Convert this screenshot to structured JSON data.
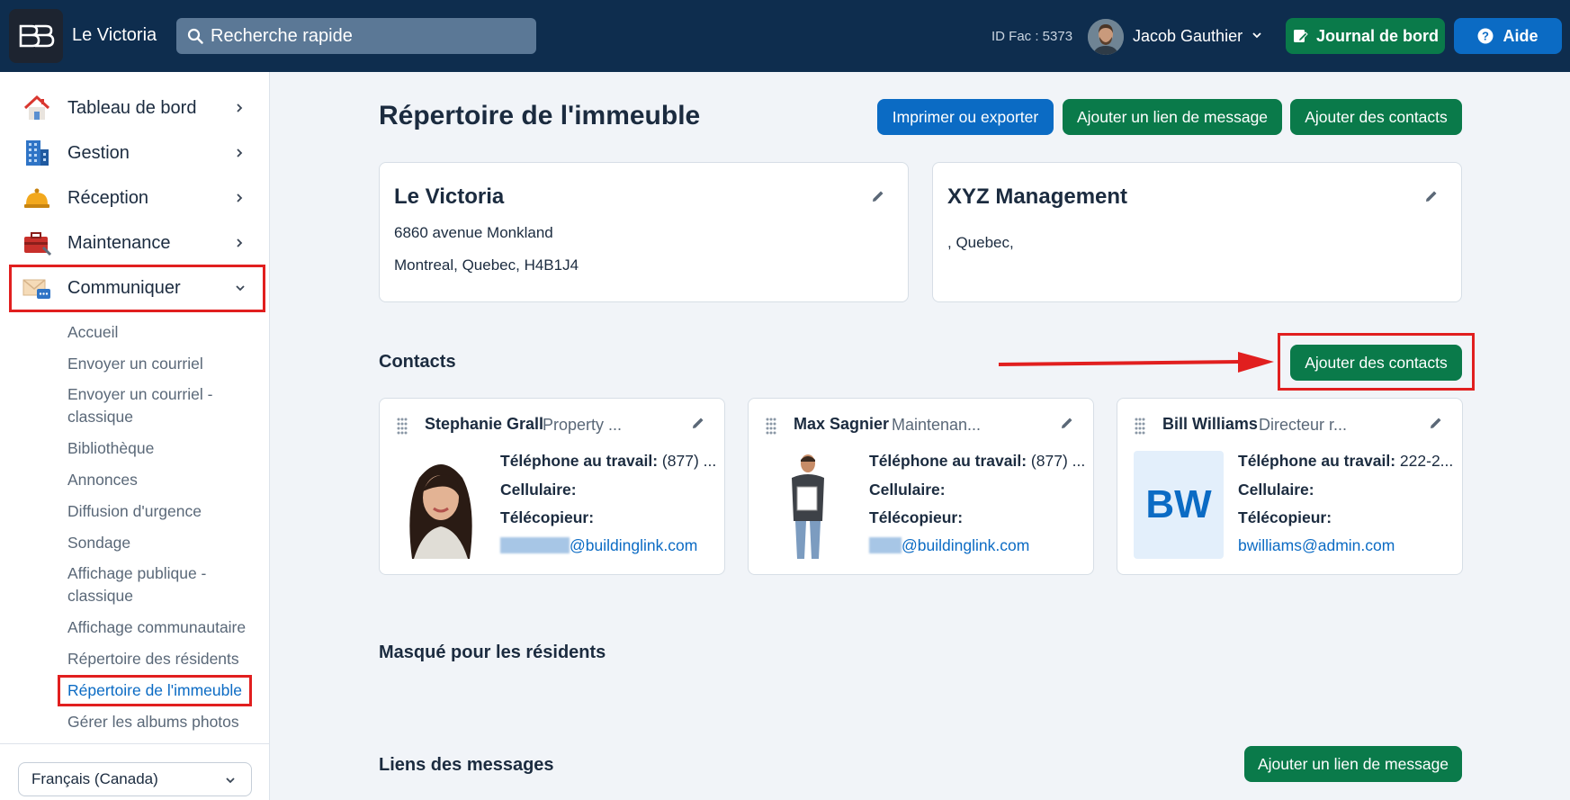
{
  "header": {
    "app_title": "Le Victoria",
    "search_placeholder": "Recherche rapide",
    "id_fac": "ID Fac : 5373",
    "user_name": "Jacob Gauthier",
    "journal_label": "Journal de bord",
    "aide_label": "Aide"
  },
  "sidebar": {
    "main_items": [
      {
        "label": "Tableau de bord",
        "icon": "house-icon"
      },
      {
        "label": "Gestion",
        "icon": "building-icon"
      },
      {
        "label": "Réception",
        "icon": "bell-icon"
      },
      {
        "label": "Maintenance",
        "icon": "toolbox-icon"
      },
      {
        "label": "Communiquer",
        "icon": "mail-chat-icon"
      }
    ],
    "sub_items": [
      "Accueil",
      "Envoyer un courriel",
      "Envoyer un courriel -",
      "classique",
      "Bibliothèque",
      "Annonces",
      "Diffusion d'urgence",
      "Sondage",
      "Affichage publique -",
      "classique",
      "Affichage communautaire",
      "Répertoire des résidents",
      "Répertoire de l'immeuble",
      "Gérer les albums photos"
    ],
    "language": "Français (Canada)"
  },
  "main": {
    "page_title": "Répertoire de l'immeuble",
    "print_label": "Imprimer ou exporter",
    "add_message_link_label": "Ajouter un lien de message",
    "add_contacts_label": "Ajouter des contacts",
    "building_card": {
      "title": "Le Victoria",
      "line1": "6860 avenue Monkland",
      "line2": "Montreal, Quebec, H4B1J4"
    },
    "management_card": {
      "title": "XYZ Management",
      "line1": ", Quebec,"
    },
    "contacts_title": "Contacts",
    "contacts_add_label": "Ajouter des contacts",
    "contacts": [
      {
        "name": "Stephanie Grall",
        "role": "Property ...",
        "phone_label": "Téléphone au travail:",
        "phone_value": "(877) ...",
        "cell_label": "Cellulaire:",
        "fax_label": "Télécopieur:",
        "email_domain": "@buildinglink.com"
      },
      {
        "name": "Max Sagnier",
        "role": "Maintenan...",
        "phone_label": "Téléphone au travail:",
        "phone_value": "(877) ...",
        "cell_label": "Cellulaire:",
        "fax_label": "Télécopieur:",
        "email_domain": "@buildinglink.com"
      },
      {
        "name": "Bill Williams",
        "role": "Directeur r...",
        "initials": "BW",
        "phone_label": "Téléphone au travail:",
        "phone_value": "222-2...",
        "cell_label": "Cellulaire:",
        "fax_label": "Télécopieur:",
        "email": "bwilliams@admin.com"
      }
    ],
    "hidden_title": "Masqué pour les résidents",
    "links_title": "Liens des messages",
    "links_add_label": "Ajouter un lien de message"
  },
  "colors": {
    "topbar": "#0e2d4e",
    "green": "#0a7a4a",
    "blue": "#0b6bc4",
    "annotation_red": "#e11f1f"
  }
}
